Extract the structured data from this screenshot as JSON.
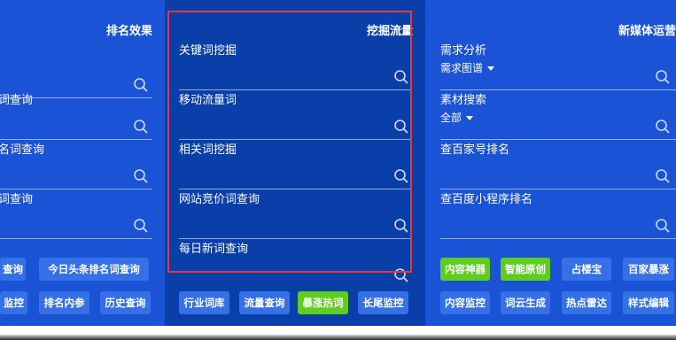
{
  "left_panel": {
    "title": "排名效果",
    "fields": [
      {
        "label": ""
      },
      {
        "label": "词查询"
      },
      {
        "label": "名词查询"
      },
      {
        "label": "词查询"
      }
    ],
    "buttons_row1": [
      {
        "label": "查询",
        "style": "blue"
      },
      {
        "label": "今日头条排名词查询",
        "style": "blue"
      }
    ],
    "buttons_row2": [
      {
        "label": "监控",
        "style": "blue"
      },
      {
        "label": "排名内参",
        "style": "blue"
      },
      {
        "label": "历史查询",
        "style": "blue"
      }
    ]
  },
  "middle_panel": {
    "title": "挖掘流量",
    "fields": [
      {
        "label": "关键词挖掘"
      },
      {
        "label": "移动流量词"
      },
      {
        "label": "相关词挖掘"
      },
      {
        "label": "网站竞价词查询"
      },
      {
        "label": "每日新词查询"
      }
    ],
    "buttons": [
      {
        "label": "行业词库",
        "style": "blue"
      },
      {
        "label": "流量查询",
        "style": "blue"
      },
      {
        "label": "暴涨热词",
        "style": "green"
      },
      {
        "label": "长尾监控",
        "style": "blue"
      }
    ]
  },
  "right_panel": {
    "title": "新媒体运营",
    "fields": [
      {
        "label": "需求分析",
        "dropdown": "需求图谱"
      },
      {
        "label": "素材搜索",
        "dropdown": "全部"
      },
      {
        "label": "查百家号排名"
      },
      {
        "label": "查百度小程序排名"
      }
    ],
    "buttons_row1": [
      {
        "label": "内容神器",
        "style": "green"
      },
      {
        "label": "智能原创",
        "style": "green"
      },
      {
        "label": "占楼宝",
        "style": "blue"
      },
      {
        "label": "百家暴涨",
        "style": "blue"
      }
    ],
    "buttons_row2": [
      {
        "label": "内容监控",
        "style": "blue"
      },
      {
        "label": "词云生成",
        "style": "blue"
      },
      {
        "label": "热点雷达",
        "style": "blue"
      },
      {
        "label": "样式编辑",
        "style": "blue"
      }
    ]
  },
  "colors": {
    "side_panel_bg": "#1a53d6",
    "middle_panel_bg": "#0a3ea8",
    "button_blue": "#3670e6",
    "button_green": "#5fcc20",
    "highlight_border": "#e23a3a"
  },
  "icons": {
    "search": "search-icon",
    "dropdown": "caret-down-icon"
  }
}
